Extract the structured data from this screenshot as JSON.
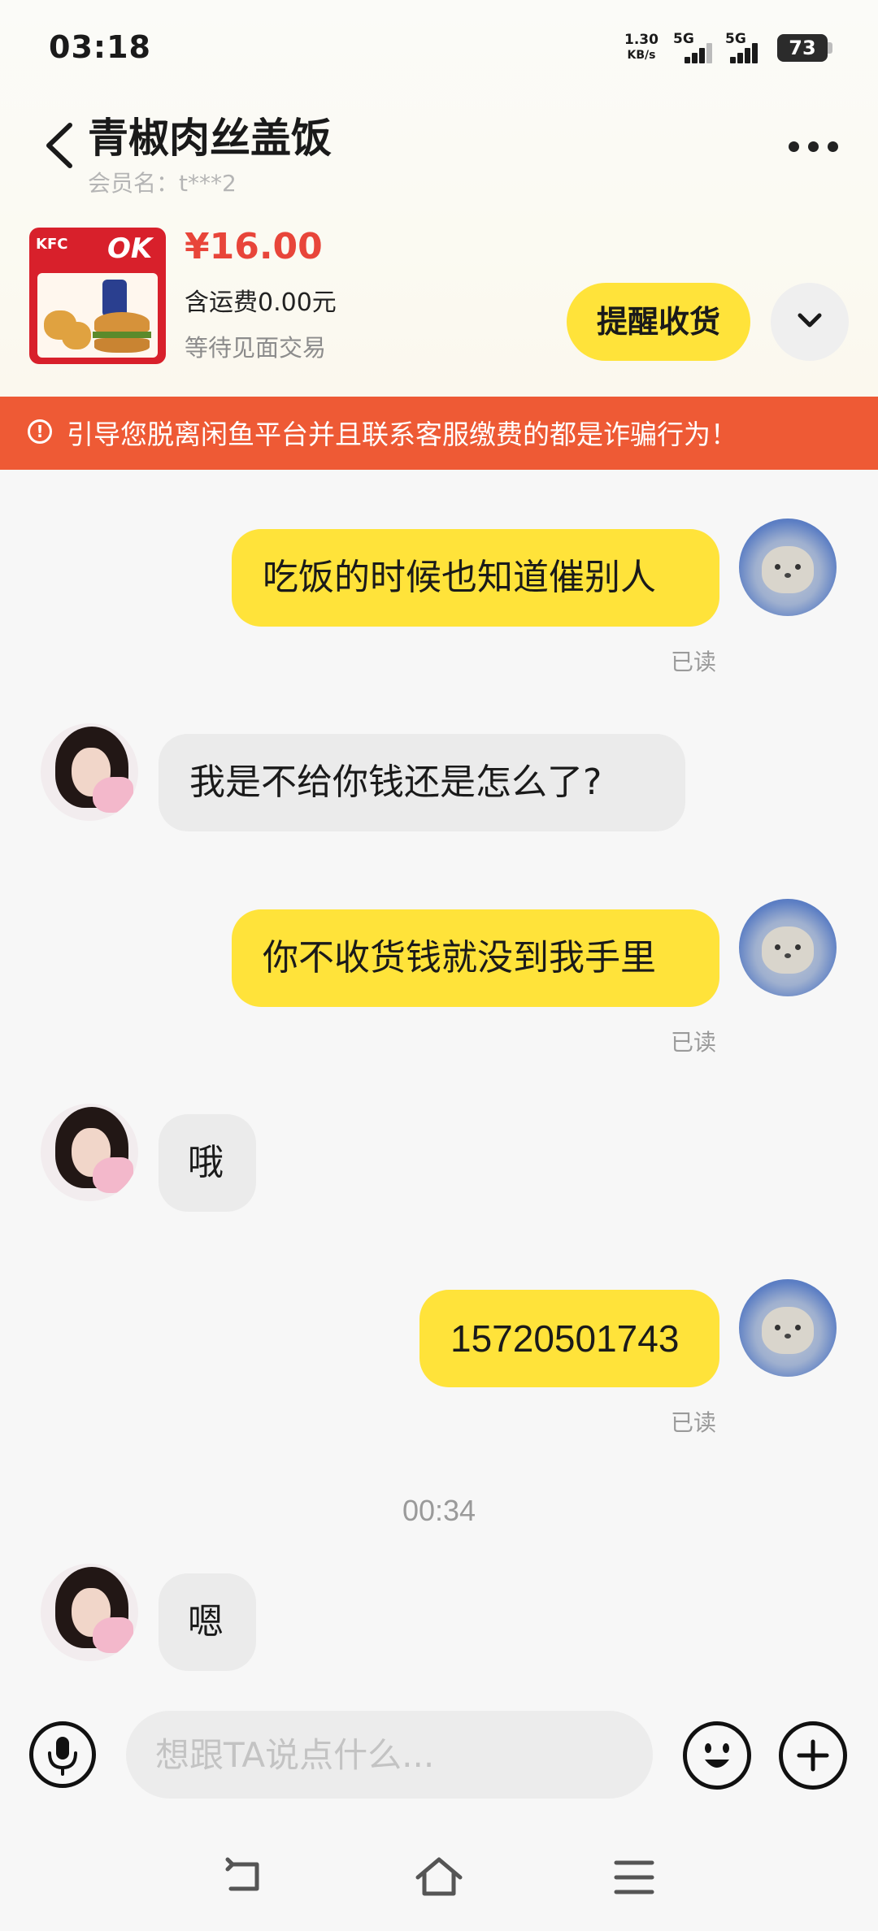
{
  "status_bar": {
    "time": "03:18",
    "speed_value": "1.30",
    "speed_unit": "KB/s",
    "network_1": "5G",
    "network_2": "5G",
    "battery": "73"
  },
  "header": {
    "title": "青椒肉丝盖饭",
    "member_name": "会员名：t***2"
  },
  "product": {
    "thumb_brand": "KFC",
    "thumb_badge": "OK",
    "price": "¥16.00",
    "shipping": "含运费0.00元",
    "status": "等待见面交易",
    "remind_button": "提醒收货"
  },
  "warning": {
    "text": "引导您脱离闲鱼平台并且联系客服缴费的都是诈骗行为！"
  },
  "messages": [
    {
      "from": "me",
      "text": "吃饭的时候也知道催别人",
      "read": "已读"
    },
    {
      "from": "other",
      "text": "我是不给你钱还是怎么了?"
    },
    {
      "from": "me",
      "text": "你不收货钱就没到我手里",
      "read": "已读"
    },
    {
      "from": "other",
      "text": "哦"
    },
    {
      "from": "me",
      "text": "15720501743",
      "read": "已读"
    },
    {
      "from": "other",
      "text": "嗯"
    }
  ],
  "timestamp": "00:34",
  "input": {
    "placeholder": "想跟TA说点什么..."
  },
  "colors": {
    "accent_yellow": "#ffe33a",
    "warning_orange": "#ee5a35",
    "price_red": "#e8453a"
  },
  "icons": [
    "back-icon",
    "more-icon",
    "chevron-down-icon",
    "mic-icon",
    "emoji-icon",
    "plus-icon",
    "nav-back-icon",
    "nav-home-icon",
    "nav-menu-icon"
  ]
}
